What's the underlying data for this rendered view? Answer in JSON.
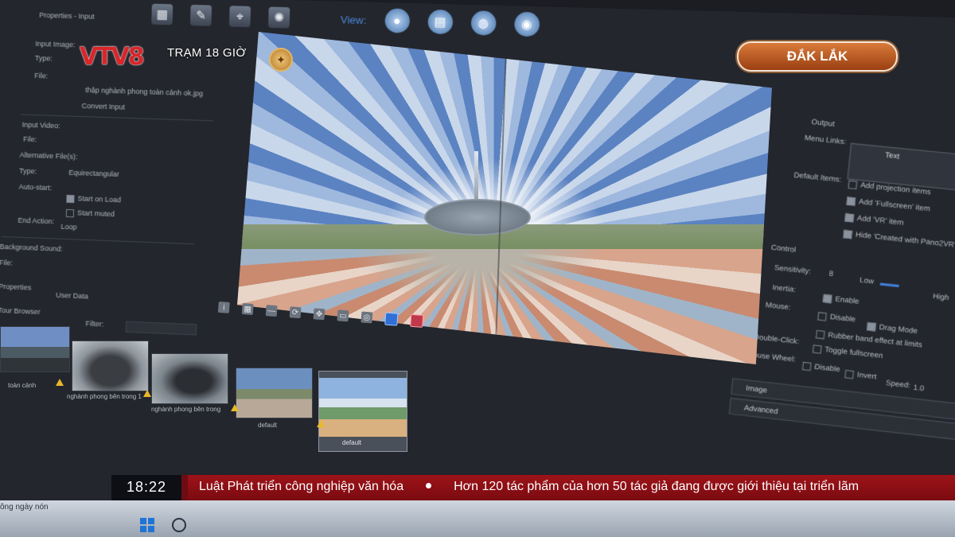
{
  "broadcast": {
    "logo": "VTV8",
    "program": "TRẠM 18 GIỜ",
    "location": "ĐẮK LẮK",
    "clock": "18:22",
    "ticker": [
      "Luật Phát triển công nghiệp văn hóa",
      "Hơn 120 tác phẩm của hơn 50 tác giả đang được giới thiệu tại triển lãm"
    ]
  },
  "app": {
    "view_label": "View:",
    "left_panel": {
      "title": "Properties - Input",
      "input_image": "Input Image:",
      "type": "Type:",
      "file": "File:",
      "file_value": "thập nghành phong toàn cảnh ok.jpg",
      "convert_input": "Convert Input",
      "input_video": "Input Video:",
      "video_file": "File:",
      "alt_files": "Alternative File(s):",
      "video_type": "Type:",
      "video_type_value": "Equirectangular",
      "auto_start": "Auto-start:",
      "start_on_load": "Start on Load",
      "start_muted": "Start muted",
      "end_action": "End Action:",
      "end_action_value": "Loop",
      "background_sound": "Background Sound:",
      "sound_file": "File:",
      "tab_properties": "Properties",
      "tab_user_data": "User Data",
      "tour_browser": "Tour Browser",
      "filter": "Filter:"
    },
    "right_panel": {
      "output": "Output",
      "menu_links": "Menu Links:",
      "text_header": "Text",
      "default_items": "Default Items:",
      "items": [
        "Add projection items",
        "Add 'Fullscreen' item",
        "Add 'VR' item",
        "Hide 'Created with Pano2VR'"
      ],
      "control": "Control",
      "sensitivity": "Sensitivity:",
      "sensitivity_value": "8",
      "low": "Low",
      "high": "High",
      "inertia": "Inertia:",
      "enable": "Enable",
      "mouse": "Mouse:",
      "disable": "Disable",
      "drag_mode": "Drag Mode",
      "rubber_band": "Rubber band effect at limits",
      "double_click": "Double-Click:",
      "toggle_fullscreen": "Toggle fullscreen",
      "mouse_wheel": "Mouse Wheel:",
      "wheel_disable": "Disable",
      "invert": "Invert",
      "speed": "Speed:",
      "speed_value": "1.0",
      "image_section": "Image",
      "advanced_section": "Advanced"
    },
    "thumbnails": [
      {
        "label": "toàn cảnh"
      },
      {
        "label": "nghành phong bên trong 1"
      },
      {
        "label": "nghành phong bên trong"
      },
      {
        "label": "default"
      },
      {
        "label": "default"
      }
    ]
  },
  "taskbar": {
    "text": "ông ngày nón"
  },
  "colors": {
    "ticker_red": "#9d1319",
    "location_orange": "#d97b3a",
    "logo_red": "#d8262b",
    "accent_blue": "#2f6fd6"
  }
}
